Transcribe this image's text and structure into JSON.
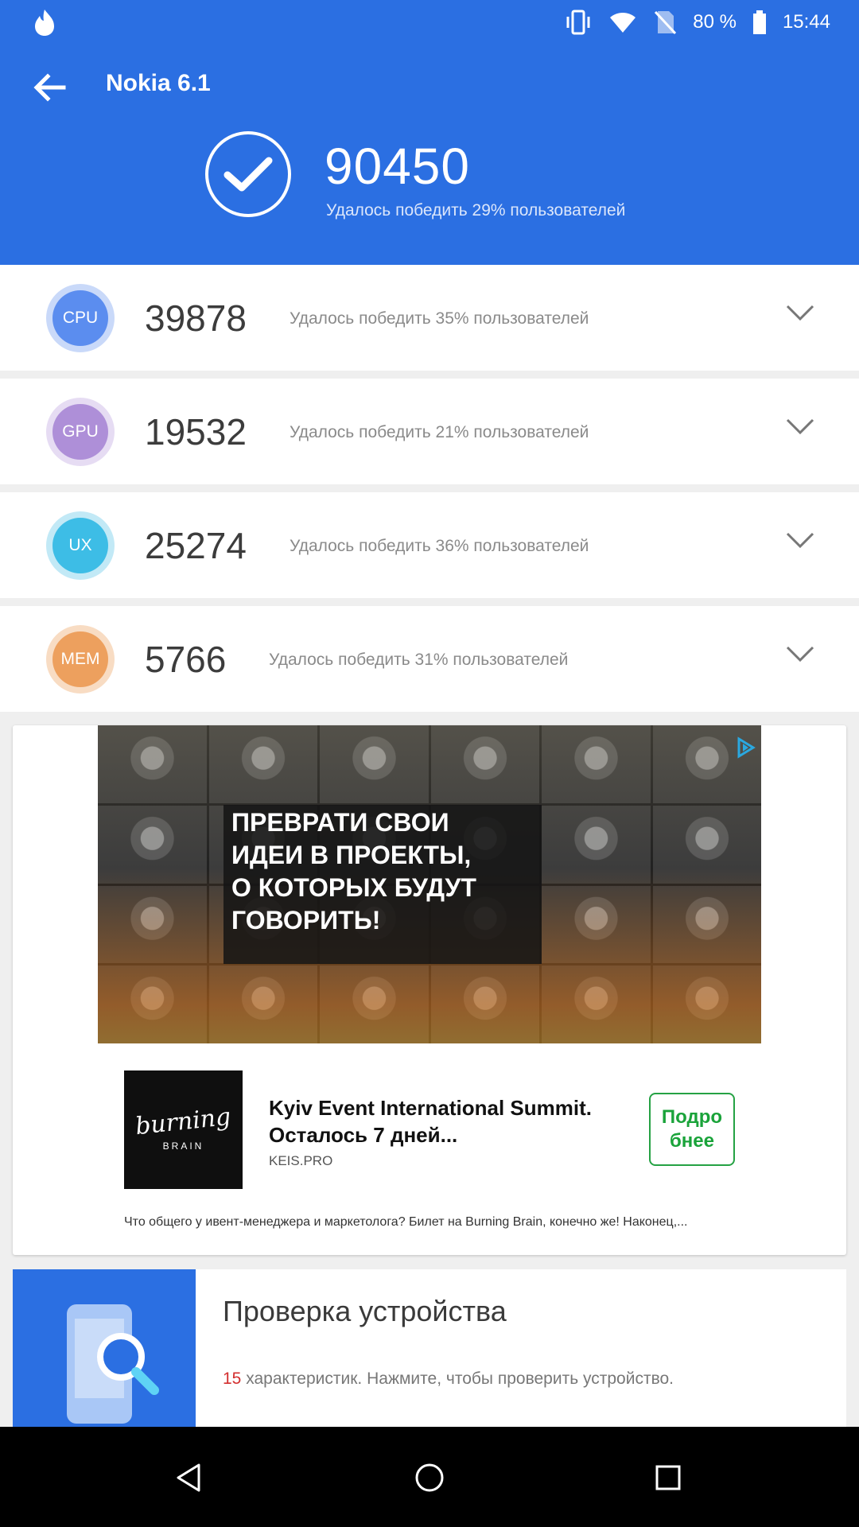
{
  "status_bar": {
    "app_icon": "tinder-flame-icon",
    "battery_percent": "80 %",
    "time": "15:44",
    "icons": [
      "vibrate-icon",
      "wifi-icon",
      "no-sim-icon",
      "battery-icon"
    ]
  },
  "app_bar": {
    "title": "Nokia 6.1",
    "back_icon": "arrow-left-icon"
  },
  "total": {
    "score": "90450",
    "subtitle": "Удалось победить 29% пользователей"
  },
  "scores": [
    {
      "badge": "CPU",
      "score": "39878",
      "subtitle": "Удалось победить 35% пользователей",
      "color": "#5b8def",
      "ring": "#c9d9f9"
    },
    {
      "badge": "GPU",
      "score": "19532",
      "subtitle": "Удалось победить 21% пользователей",
      "color": "#ae8fd8",
      "ring": "#e6dcf3"
    },
    {
      "badge": "UX",
      "score": "25274",
      "subtitle": "Удалось победить 36% пользователей",
      "color": "#3dbde6",
      "ring": "#c2e9f6"
    },
    {
      "badge": "MEM",
      "score": "5766",
      "subtitle": "Удалось победить 31% пользователей",
      "color": "#eda05e",
      "ring": "#f8dcc3"
    }
  ],
  "ad": {
    "banner_headline": "ПРЕВРАТИ СВОИ\nИДЕИ В ПРОЕКТЫ,\nО КОТОРЫХ БУДУТ\nГОВОРИТЬ!",
    "logo_script": "burning",
    "logo_sub": "BRAIN",
    "title": "Kyiv Event International Summit. Осталось 7 дней...",
    "domain": "KEIS.PRO",
    "cta": "Подро\nбнее",
    "description": "Что общего у ивент-менеджера и маркетолога? Билет на Burning Brain, конечно же! Наконец,...",
    "adchoices_icon": "adchoices-icon"
  },
  "device_check": {
    "title": "Проверка устройства",
    "count": "15",
    "subtitle_rest": " характеристик. Нажмите, чтобы проверить устройство.",
    "icon": "phone-search-icon"
  },
  "nav": {
    "back_icon": "triangle-back-icon",
    "home_icon": "circle-home-icon",
    "recents_icon": "square-recents-icon"
  },
  "colors": {
    "brand_blue": "#2b6fe2",
    "cta_green": "#1aa33a",
    "count_red": "#d32f2f"
  }
}
